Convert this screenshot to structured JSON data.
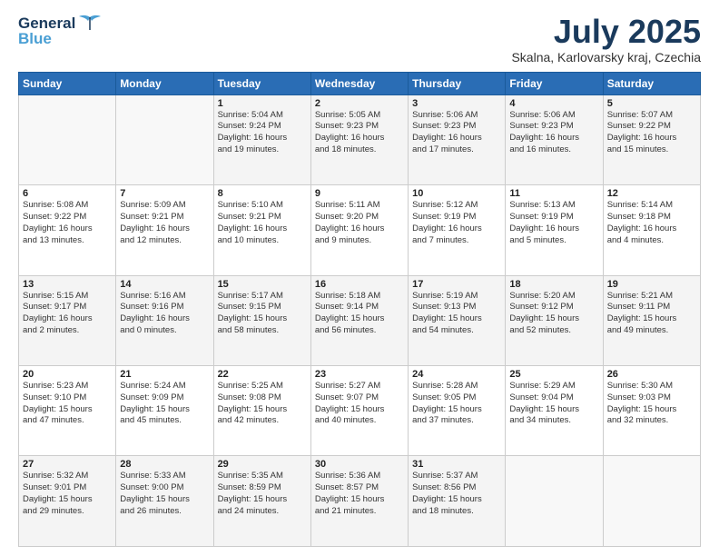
{
  "header": {
    "logo_general": "General",
    "logo_blue": "Blue",
    "title": "July 2025",
    "location": "Skalna, Karlovarsky kraj, Czechia"
  },
  "days_of_week": [
    "Sunday",
    "Monday",
    "Tuesday",
    "Wednesday",
    "Thursday",
    "Friday",
    "Saturday"
  ],
  "weeks": [
    [
      {
        "day": "",
        "sunrise": "",
        "sunset": "",
        "daylight": ""
      },
      {
        "day": "",
        "sunrise": "",
        "sunset": "",
        "daylight": ""
      },
      {
        "day": "1",
        "sunrise": "Sunrise: 5:04 AM",
        "sunset": "Sunset: 9:24 PM",
        "daylight": "Daylight: 16 hours and 19 minutes."
      },
      {
        "day": "2",
        "sunrise": "Sunrise: 5:05 AM",
        "sunset": "Sunset: 9:23 PM",
        "daylight": "Daylight: 16 hours and 18 minutes."
      },
      {
        "day": "3",
        "sunrise": "Sunrise: 5:06 AM",
        "sunset": "Sunset: 9:23 PM",
        "daylight": "Daylight: 16 hours and 17 minutes."
      },
      {
        "day": "4",
        "sunrise": "Sunrise: 5:06 AM",
        "sunset": "Sunset: 9:23 PM",
        "daylight": "Daylight: 16 hours and 16 minutes."
      },
      {
        "day": "5",
        "sunrise": "Sunrise: 5:07 AM",
        "sunset": "Sunset: 9:22 PM",
        "daylight": "Daylight: 16 hours and 15 minutes."
      }
    ],
    [
      {
        "day": "6",
        "sunrise": "Sunrise: 5:08 AM",
        "sunset": "Sunset: 9:22 PM",
        "daylight": "Daylight: 16 hours and 13 minutes."
      },
      {
        "day": "7",
        "sunrise": "Sunrise: 5:09 AM",
        "sunset": "Sunset: 9:21 PM",
        "daylight": "Daylight: 16 hours and 12 minutes."
      },
      {
        "day": "8",
        "sunrise": "Sunrise: 5:10 AM",
        "sunset": "Sunset: 9:21 PM",
        "daylight": "Daylight: 16 hours and 10 minutes."
      },
      {
        "day": "9",
        "sunrise": "Sunrise: 5:11 AM",
        "sunset": "Sunset: 9:20 PM",
        "daylight": "Daylight: 16 hours and 9 minutes."
      },
      {
        "day": "10",
        "sunrise": "Sunrise: 5:12 AM",
        "sunset": "Sunset: 9:19 PM",
        "daylight": "Daylight: 16 hours and 7 minutes."
      },
      {
        "day": "11",
        "sunrise": "Sunrise: 5:13 AM",
        "sunset": "Sunset: 9:19 PM",
        "daylight": "Daylight: 16 hours and 5 minutes."
      },
      {
        "day": "12",
        "sunrise": "Sunrise: 5:14 AM",
        "sunset": "Sunset: 9:18 PM",
        "daylight": "Daylight: 16 hours and 4 minutes."
      }
    ],
    [
      {
        "day": "13",
        "sunrise": "Sunrise: 5:15 AM",
        "sunset": "Sunset: 9:17 PM",
        "daylight": "Daylight: 16 hours and 2 minutes."
      },
      {
        "day": "14",
        "sunrise": "Sunrise: 5:16 AM",
        "sunset": "Sunset: 9:16 PM",
        "daylight": "Daylight: 16 hours and 0 minutes."
      },
      {
        "day": "15",
        "sunrise": "Sunrise: 5:17 AM",
        "sunset": "Sunset: 9:15 PM",
        "daylight": "Daylight: 15 hours and 58 minutes."
      },
      {
        "day": "16",
        "sunrise": "Sunrise: 5:18 AM",
        "sunset": "Sunset: 9:14 PM",
        "daylight": "Daylight: 15 hours and 56 minutes."
      },
      {
        "day": "17",
        "sunrise": "Sunrise: 5:19 AM",
        "sunset": "Sunset: 9:13 PM",
        "daylight": "Daylight: 15 hours and 54 minutes."
      },
      {
        "day": "18",
        "sunrise": "Sunrise: 5:20 AM",
        "sunset": "Sunset: 9:12 PM",
        "daylight": "Daylight: 15 hours and 52 minutes."
      },
      {
        "day": "19",
        "sunrise": "Sunrise: 5:21 AM",
        "sunset": "Sunset: 9:11 PM",
        "daylight": "Daylight: 15 hours and 49 minutes."
      }
    ],
    [
      {
        "day": "20",
        "sunrise": "Sunrise: 5:23 AM",
        "sunset": "Sunset: 9:10 PM",
        "daylight": "Daylight: 15 hours and 47 minutes."
      },
      {
        "day": "21",
        "sunrise": "Sunrise: 5:24 AM",
        "sunset": "Sunset: 9:09 PM",
        "daylight": "Daylight: 15 hours and 45 minutes."
      },
      {
        "day": "22",
        "sunrise": "Sunrise: 5:25 AM",
        "sunset": "Sunset: 9:08 PM",
        "daylight": "Daylight: 15 hours and 42 minutes."
      },
      {
        "day": "23",
        "sunrise": "Sunrise: 5:27 AM",
        "sunset": "Sunset: 9:07 PM",
        "daylight": "Daylight: 15 hours and 40 minutes."
      },
      {
        "day": "24",
        "sunrise": "Sunrise: 5:28 AM",
        "sunset": "Sunset: 9:05 PM",
        "daylight": "Daylight: 15 hours and 37 minutes."
      },
      {
        "day": "25",
        "sunrise": "Sunrise: 5:29 AM",
        "sunset": "Sunset: 9:04 PM",
        "daylight": "Daylight: 15 hours and 34 minutes."
      },
      {
        "day": "26",
        "sunrise": "Sunrise: 5:30 AM",
        "sunset": "Sunset: 9:03 PM",
        "daylight": "Daylight: 15 hours and 32 minutes."
      }
    ],
    [
      {
        "day": "27",
        "sunrise": "Sunrise: 5:32 AM",
        "sunset": "Sunset: 9:01 PM",
        "daylight": "Daylight: 15 hours and 29 minutes."
      },
      {
        "day": "28",
        "sunrise": "Sunrise: 5:33 AM",
        "sunset": "Sunset: 9:00 PM",
        "daylight": "Daylight: 15 hours and 26 minutes."
      },
      {
        "day": "29",
        "sunrise": "Sunrise: 5:35 AM",
        "sunset": "Sunset: 8:59 PM",
        "daylight": "Daylight: 15 hours and 24 minutes."
      },
      {
        "day": "30",
        "sunrise": "Sunrise: 5:36 AM",
        "sunset": "Sunset: 8:57 PM",
        "daylight": "Daylight: 15 hours and 21 minutes."
      },
      {
        "day": "31",
        "sunrise": "Sunrise: 5:37 AM",
        "sunset": "Sunset: 8:56 PM",
        "daylight": "Daylight: 15 hours and 18 minutes."
      },
      {
        "day": "",
        "sunrise": "",
        "sunset": "",
        "daylight": ""
      },
      {
        "day": "",
        "sunrise": "",
        "sunset": "",
        "daylight": ""
      }
    ]
  ]
}
